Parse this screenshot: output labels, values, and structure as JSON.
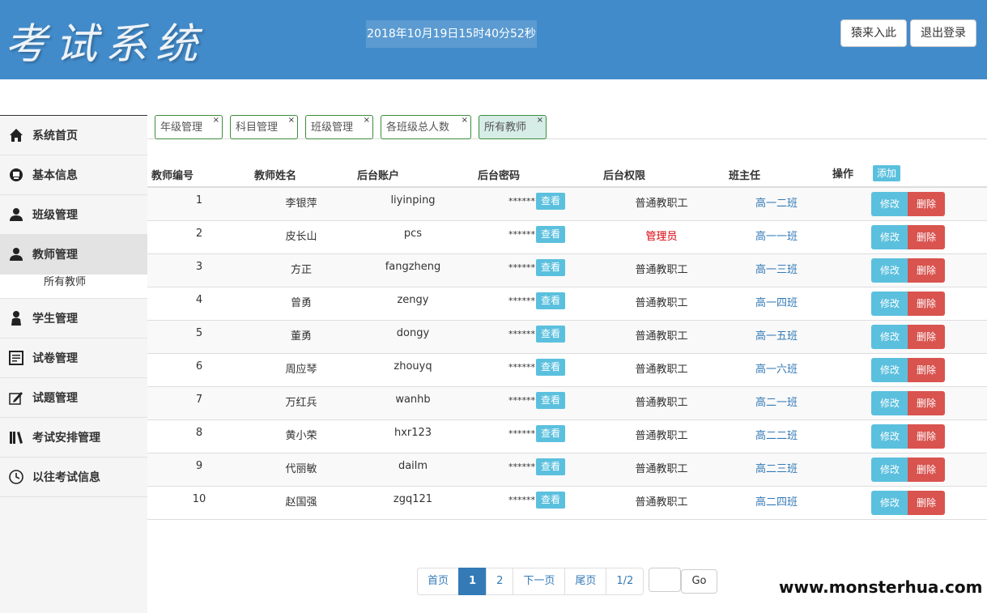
{
  "header": {
    "logo": "考试系统",
    "clock": "2018年10月19日15时40分52秒",
    "btn_enter": "猿来入此",
    "btn_logout": "退出登录"
  },
  "sidebar": {
    "items": [
      {
        "label": "系统首页",
        "icon": "home-icon"
      },
      {
        "label": "基本信息",
        "icon": "info-icon"
      },
      {
        "label": "班级管理",
        "icon": "user-icon"
      },
      {
        "label": "教师管理",
        "icon": "user-icon"
      },
      {
        "label": "学生管理",
        "icon": "person-icon"
      },
      {
        "label": "试卷管理",
        "icon": "document-icon"
      },
      {
        "label": "试题管理",
        "icon": "edit-icon"
      },
      {
        "label": "考试安排管理",
        "icon": "books-icon"
      },
      {
        "label": "以往考试信息",
        "icon": "clock-icon"
      }
    ],
    "sub_item": "所有教师"
  },
  "tabs": [
    "年级管理",
    "科目管理",
    "班级管理",
    "各班级总人数",
    "所有教师"
  ],
  "tab_close": "×",
  "table": {
    "headers": {
      "id": "教师编号",
      "name": "教师姓名",
      "account": "后台账户",
      "password": "后台密码",
      "role": "后台权限",
      "class": "班主任",
      "action": "操作"
    },
    "add_label": "添加",
    "view_label": "查看",
    "edit_label": "修改",
    "delete_label": "删除",
    "password_mask": "******",
    "rows": [
      {
        "id": "1",
        "name": "李银萍",
        "account": "liyinping",
        "role": "普通教职工",
        "class": "高一二班"
      },
      {
        "id": "2",
        "name": "皮长山",
        "account": "pcs",
        "role": "管理员",
        "class": "高一一班"
      },
      {
        "id": "3",
        "name": "方正",
        "account": "fangzheng",
        "role": "普通教职工",
        "class": "高一三班"
      },
      {
        "id": "4",
        "name": "曾勇",
        "account": "zengy",
        "role": "普通教职工",
        "class": "高一四班"
      },
      {
        "id": "5",
        "name": "董勇",
        "account": "dongy",
        "role": "普通教职工",
        "class": "高一五班"
      },
      {
        "id": "6",
        "name": "周应琴",
        "account": "zhouyq",
        "role": "普通教职工",
        "class": "高一六班"
      },
      {
        "id": "7",
        "name": "万红兵",
        "account": "wanhb",
        "role": "普通教职工",
        "class": "高二一班"
      },
      {
        "id": "8",
        "name": "黄小荣",
        "account": "hxr123",
        "role": "普通教职工",
        "class": "高二二班"
      },
      {
        "id": "9",
        "name": "代丽敏",
        "account": "dailm",
        "role": "普通教职工",
        "class": "高二三班"
      },
      {
        "id": "10",
        "name": "赵国强",
        "account": "zgq121",
        "role": "普通教职工",
        "class": "高二四班"
      }
    ]
  },
  "pagination": {
    "first": "首页",
    "page1": "1",
    "page2": "2",
    "next": "下一页",
    "last": "尾页",
    "info": "1/2",
    "go": "Go"
  },
  "watermark": "www.monsterhua.com",
  "colors": {
    "header_bg": "#428bca",
    "info_btn": "#5bc0de",
    "danger_btn": "#d9534f",
    "link": "#337ab7",
    "admin": "#d9000a"
  }
}
